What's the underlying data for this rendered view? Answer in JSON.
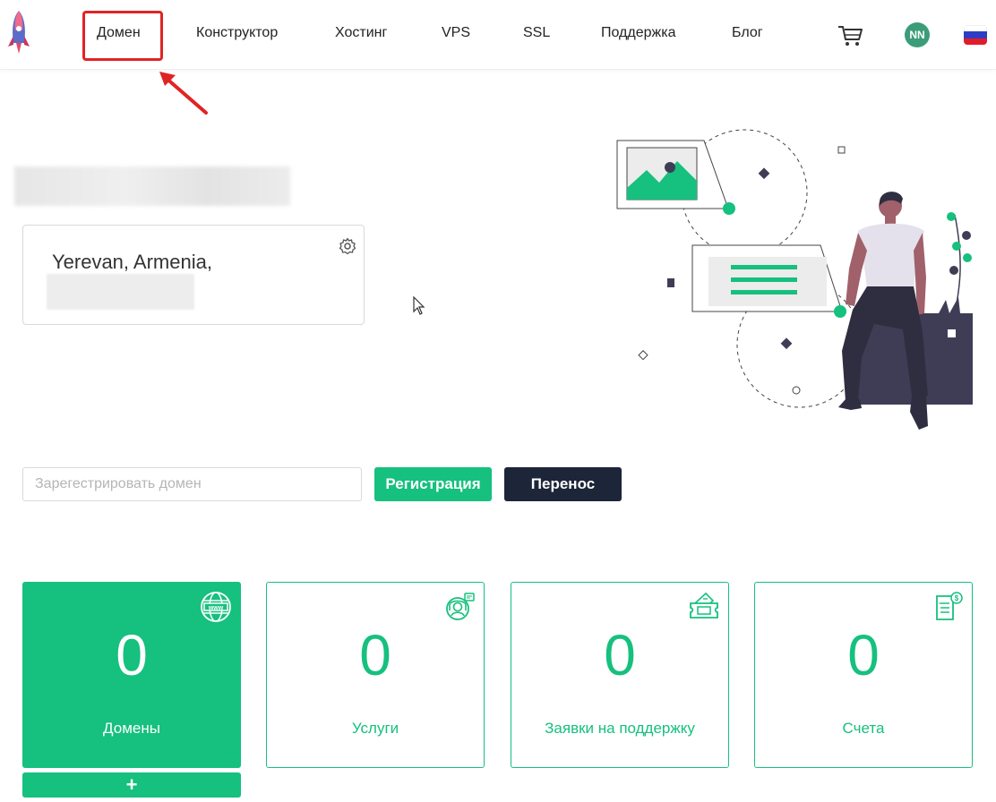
{
  "nav": {
    "items": [
      {
        "label": "Домен"
      },
      {
        "label": "Конструктор"
      },
      {
        "label": "Хостинг"
      },
      {
        "label": "VPS"
      },
      {
        "label": "SSL"
      },
      {
        "label": "Поддержка"
      },
      {
        "label": "Блог"
      }
    ],
    "avatar_initials": "NN",
    "language_flag": "russia-flag-icon",
    "cart_icon": "cart-icon"
  },
  "profile": {
    "location": "Yerevan, Armenia,"
  },
  "domain_search": {
    "placeholder": "Зарегестрировать домен",
    "register_label": "Регистрация",
    "transfer_label": "Перенос"
  },
  "stats": [
    {
      "value": "0",
      "label": "Домены",
      "icon": "globe-www-icon"
    },
    {
      "value": "0",
      "label": "Услуги",
      "icon": "support-agent-icon"
    },
    {
      "value": "0",
      "label": "Заявки на поддержку",
      "icon": "ticket-icon"
    },
    {
      "value": "0",
      "label": "Счета",
      "icon": "invoice-icon"
    }
  ],
  "add_label": "+",
  "colors": {
    "accent": "#16c07e",
    "dark_button": "#1d2538",
    "highlight": "#e02424",
    "avatar": "#3c9c7a"
  }
}
